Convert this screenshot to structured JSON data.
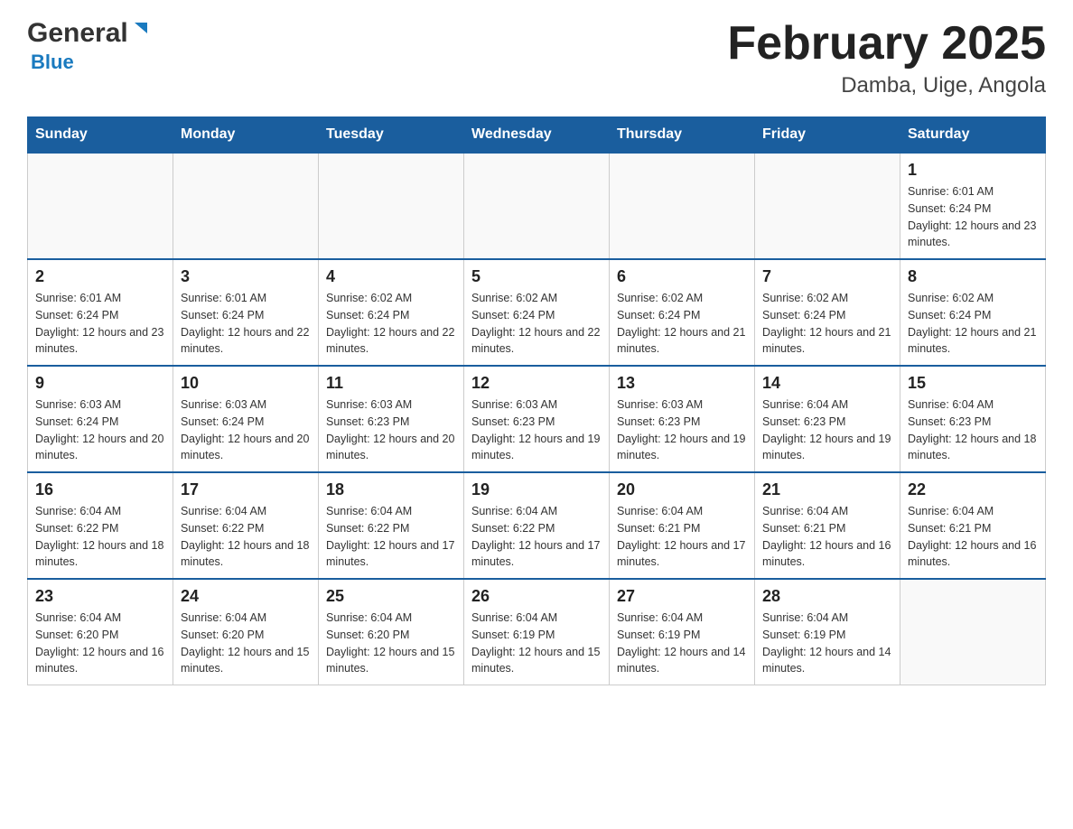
{
  "header": {
    "logo": {
      "general": "General",
      "blue": "Blue"
    },
    "title": "February 2025",
    "subtitle": "Damba, Uige, Angola"
  },
  "weekdays": [
    "Sunday",
    "Monday",
    "Tuesday",
    "Wednesday",
    "Thursday",
    "Friday",
    "Saturday"
  ],
  "weeks": [
    [
      {
        "day": "",
        "info": ""
      },
      {
        "day": "",
        "info": ""
      },
      {
        "day": "",
        "info": ""
      },
      {
        "day": "",
        "info": ""
      },
      {
        "day": "",
        "info": ""
      },
      {
        "day": "",
        "info": ""
      },
      {
        "day": "1",
        "info": "Sunrise: 6:01 AM\nSunset: 6:24 PM\nDaylight: 12 hours and 23 minutes."
      }
    ],
    [
      {
        "day": "2",
        "info": "Sunrise: 6:01 AM\nSunset: 6:24 PM\nDaylight: 12 hours and 23 minutes."
      },
      {
        "day": "3",
        "info": "Sunrise: 6:01 AM\nSunset: 6:24 PM\nDaylight: 12 hours and 22 minutes."
      },
      {
        "day": "4",
        "info": "Sunrise: 6:02 AM\nSunset: 6:24 PM\nDaylight: 12 hours and 22 minutes."
      },
      {
        "day": "5",
        "info": "Sunrise: 6:02 AM\nSunset: 6:24 PM\nDaylight: 12 hours and 22 minutes."
      },
      {
        "day": "6",
        "info": "Sunrise: 6:02 AM\nSunset: 6:24 PM\nDaylight: 12 hours and 21 minutes."
      },
      {
        "day": "7",
        "info": "Sunrise: 6:02 AM\nSunset: 6:24 PM\nDaylight: 12 hours and 21 minutes."
      },
      {
        "day": "8",
        "info": "Sunrise: 6:02 AM\nSunset: 6:24 PM\nDaylight: 12 hours and 21 minutes."
      }
    ],
    [
      {
        "day": "9",
        "info": "Sunrise: 6:03 AM\nSunset: 6:24 PM\nDaylight: 12 hours and 20 minutes."
      },
      {
        "day": "10",
        "info": "Sunrise: 6:03 AM\nSunset: 6:24 PM\nDaylight: 12 hours and 20 minutes."
      },
      {
        "day": "11",
        "info": "Sunrise: 6:03 AM\nSunset: 6:23 PM\nDaylight: 12 hours and 20 minutes."
      },
      {
        "day": "12",
        "info": "Sunrise: 6:03 AM\nSunset: 6:23 PM\nDaylight: 12 hours and 19 minutes."
      },
      {
        "day": "13",
        "info": "Sunrise: 6:03 AM\nSunset: 6:23 PM\nDaylight: 12 hours and 19 minutes."
      },
      {
        "day": "14",
        "info": "Sunrise: 6:04 AM\nSunset: 6:23 PM\nDaylight: 12 hours and 19 minutes."
      },
      {
        "day": "15",
        "info": "Sunrise: 6:04 AM\nSunset: 6:23 PM\nDaylight: 12 hours and 18 minutes."
      }
    ],
    [
      {
        "day": "16",
        "info": "Sunrise: 6:04 AM\nSunset: 6:22 PM\nDaylight: 12 hours and 18 minutes."
      },
      {
        "day": "17",
        "info": "Sunrise: 6:04 AM\nSunset: 6:22 PM\nDaylight: 12 hours and 18 minutes."
      },
      {
        "day": "18",
        "info": "Sunrise: 6:04 AM\nSunset: 6:22 PM\nDaylight: 12 hours and 17 minutes."
      },
      {
        "day": "19",
        "info": "Sunrise: 6:04 AM\nSunset: 6:22 PM\nDaylight: 12 hours and 17 minutes."
      },
      {
        "day": "20",
        "info": "Sunrise: 6:04 AM\nSunset: 6:21 PM\nDaylight: 12 hours and 17 minutes."
      },
      {
        "day": "21",
        "info": "Sunrise: 6:04 AM\nSunset: 6:21 PM\nDaylight: 12 hours and 16 minutes."
      },
      {
        "day": "22",
        "info": "Sunrise: 6:04 AM\nSunset: 6:21 PM\nDaylight: 12 hours and 16 minutes."
      }
    ],
    [
      {
        "day": "23",
        "info": "Sunrise: 6:04 AM\nSunset: 6:20 PM\nDaylight: 12 hours and 16 minutes."
      },
      {
        "day": "24",
        "info": "Sunrise: 6:04 AM\nSunset: 6:20 PM\nDaylight: 12 hours and 15 minutes."
      },
      {
        "day": "25",
        "info": "Sunrise: 6:04 AM\nSunset: 6:20 PM\nDaylight: 12 hours and 15 minutes."
      },
      {
        "day": "26",
        "info": "Sunrise: 6:04 AM\nSunset: 6:19 PM\nDaylight: 12 hours and 15 minutes."
      },
      {
        "day": "27",
        "info": "Sunrise: 6:04 AM\nSunset: 6:19 PM\nDaylight: 12 hours and 14 minutes."
      },
      {
        "day": "28",
        "info": "Sunrise: 6:04 AM\nSunset: 6:19 PM\nDaylight: 12 hours and 14 minutes."
      },
      {
        "day": "",
        "info": ""
      }
    ]
  ]
}
